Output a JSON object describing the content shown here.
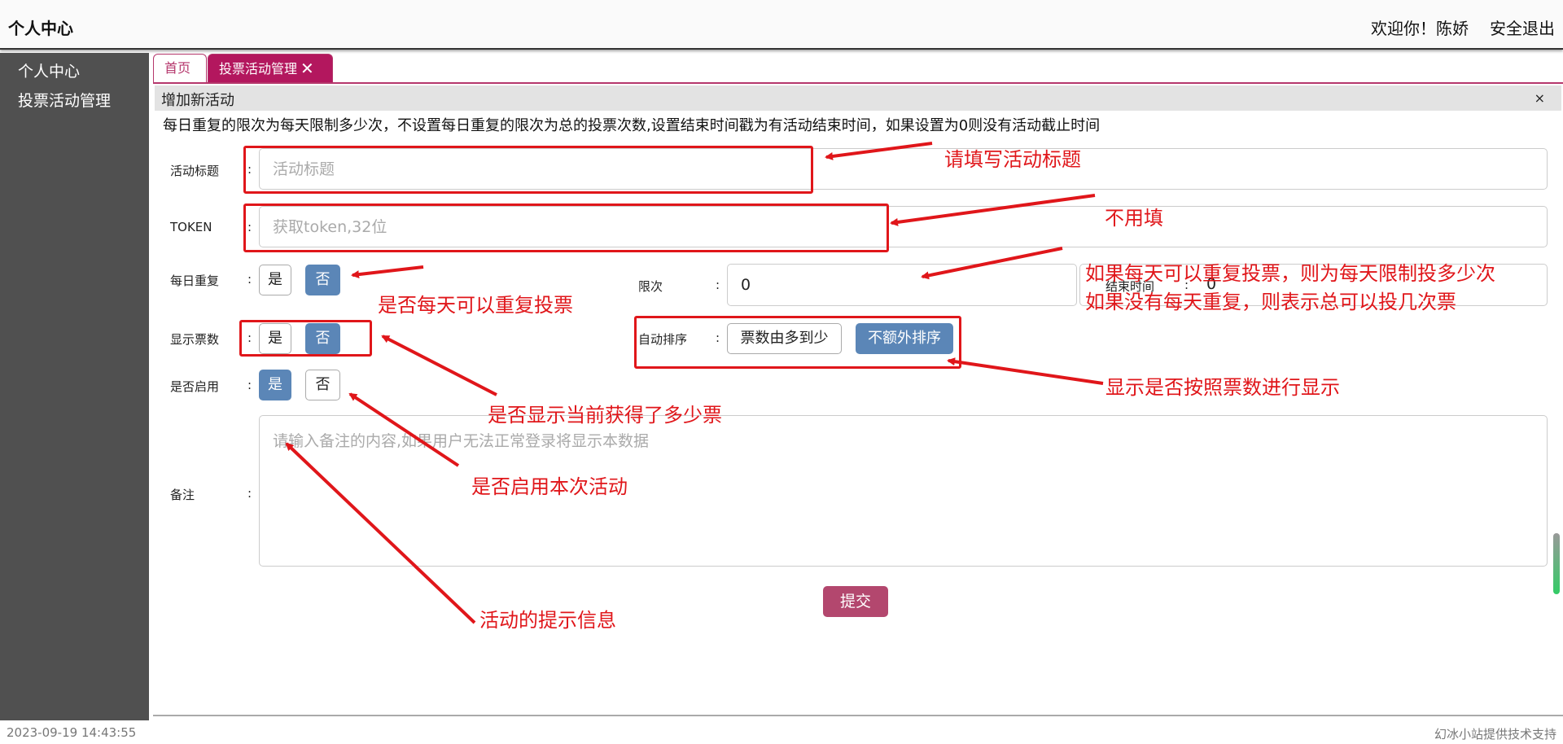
{
  "header": {
    "brand": "个人中心",
    "welcome": "欢迎你！陈娇",
    "logout": "安全退出"
  },
  "sidebar": {
    "items": [
      {
        "label": "个人中心"
      },
      {
        "label": "投票活动管理"
      }
    ]
  },
  "tabs": [
    {
      "label": "首页"
    },
    {
      "label": "投票活动管理"
    }
  ],
  "panel": {
    "title": "增加新活动",
    "close": "×",
    "note": "每日重复的限次为每天限制多少次，不设置每日重复的限次为总的投票次数,设置结束时间戳为有活动结束时间，如果设置为0则没有活动截止时间"
  },
  "form": {
    "colon": ":",
    "title": {
      "label": "活动标题",
      "placeholder": "活动标题"
    },
    "token": {
      "label": "TOKEN",
      "placeholder": "获取token,32位"
    },
    "daily_repeat": {
      "label": "每日重复",
      "yes": "是",
      "no": "否",
      "selected": "否"
    },
    "limit": {
      "label": "限次",
      "value": "0"
    },
    "end_time": {
      "label": "结束时间",
      "value": "0"
    },
    "show_votes": {
      "label": "显示票数",
      "yes": "是",
      "no": "否",
      "selected": "否"
    },
    "auto_sort": {
      "label": "自动排序",
      "opt_desc": "票数由多到少",
      "opt_none": "不额外排序",
      "selected": "不额外排序"
    },
    "enabled": {
      "label": "是否启用",
      "yes": "是",
      "no": "否",
      "selected": "是"
    },
    "remark": {
      "label": "备注",
      "placeholder": "请输入备注的内容,如果用户无法正常登录将显示本数据"
    },
    "submit": "提交"
  },
  "footer": {
    "timestamp": "2023-09-19 14:43:55",
    "credit": "幻冰小站提供技术支持"
  },
  "annotations": {
    "title": "请填写活动标题",
    "token": "不用填",
    "limit_1": "如果每天可以重复投票，则为每天限制投多少次",
    "limit_2": "如果没有每天重复，则表示总可以投几次票",
    "daily": "是否每天可以重复投票",
    "sort": "显示是否按照票数进行显示",
    "show_votes": "是否显示当前获得了多少票",
    "enabled": "是否启用本次活动",
    "remark": "活动的提示信息"
  },
  "colors": {
    "accent": "#b3175e",
    "selected": "#5b86b7",
    "annotation": "#e0161a",
    "sidebar": "#505050"
  }
}
